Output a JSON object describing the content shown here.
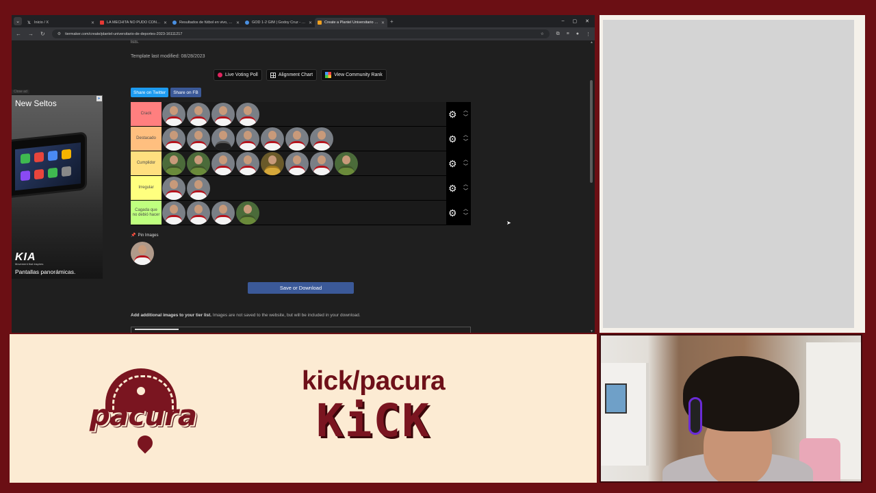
{
  "browser": {
    "tabs": [
      {
        "label": "Inicio / X",
        "favicon_color": "#ffffff",
        "active": false
      },
      {
        "label": "LA MECHITA NO PUDO CON LA U...",
        "favicon_color": "#e53935",
        "active": false
      },
      {
        "label": "Resultados de fútbol en vivo, M...",
        "favicon_color": "#4a90e2",
        "active": false
      },
      {
        "label": "GOD 1-2 GIM | Godoy Cruz - Gi...",
        "favicon_color": "#4a90e2",
        "active": false
      },
      {
        "label": "Create a Plantel Universitario de...",
        "favicon_color": "#f0a020",
        "active": true
      }
    ],
    "url": "tiermaker.com/create/plantel-universitario-de-deportes-2023-16111217"
  },
  "page": {
    "top_fragment": "lists.",
    "template_modified": "Template last modified: 08/28/2023",
    "buttons": {
      "live_voting": "Live Voting Poll",
      "alignment_chart": "Alignment Chart",
      "community_rank": "View Community Rank"
    },
    "share_twitter": "Share on Twitter",
    "share_fb": "Share on FB",
    "tiers": [
      {
        "label": "Crack",
        "color": "#ff7f7f",
        "players": [
          "white",
          "white",
          "white",
          "white"
        ]
      },
      {
        "label": "Destacado",
        "color": "#ffbf7f",
        "players": [
          "white",
          "white",
          "black",
          "white",
          "white",
          "white",
          "white"
        ]
      },
      {
        "label": "Cumplidor",
        "color": "#ffdf7f",
        "players": [
          "green",
          "green",
          "white",
          "white",
          "yellow",
          "white",
          "white",
          "green"
        ]
      },
      {
        "label": "Irregular",
        "color": "#ffff7f",
        "players": [
          "white",
          "white"
        ]
      },
      {
        "label": "Cagada que no debió hacer",
        "color": "#bfff7f",
        "players": [
          "white",
          "white",
          "white",
          "green"
        ]
      }
    ],
    "pin_images": "Pin Images",
    "save_download": "Save or Download",
    "additional_bold": "Add additional images to your tier list.",
    "additional_rest": " Images are not saved to the website, but will be included in your download."
  },
  "ad": {
    "label": "Close ad",
    "headline": "New Seltos",
    "brand": "KIA",
    "tagline": "Movement that inspires",
    "caption": "Pantallas panorámicas."
  },
  "overlay": {
    "logo_text": "pacura",
    "kick_handle": "kick/pacura",
    "kick_logo": "KiCK"
  }
}
